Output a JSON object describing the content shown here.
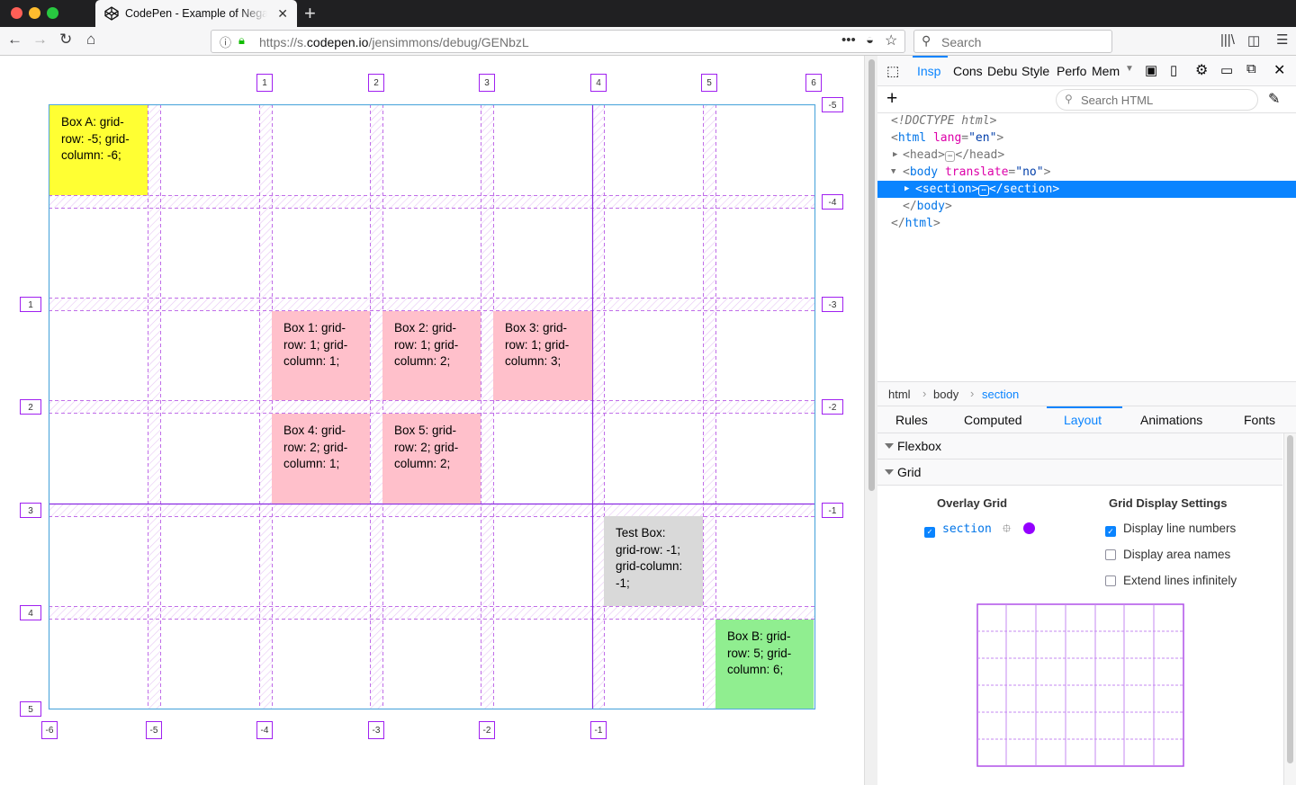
{
  "browser": {
    "tab_title": "CodePen - Example of Negative",
    "url_prefix": "https://s.",
    "url_domain": "codepen.io",
    "url_path": "/jensimmons/debug/GENbzL",
    "search_placeholder": "Search"
  },
  "page": {
    "box_a": "Box A: grid-row: -5; grid-column: -6;",
    "box_1": "Box 1: grid-row: 1; grid-column: 1;",
    "box_2": "Box 2: grid-row: 1; grid-column: 2;",
    "box_3": "Box 3: grid-row: 1; grid-column: 3;",
    "box_4": "Box 4: grid-row: 2; grid-column: 1;",
    "box_5": "Box 5: grid-row: 2; grid-column: 2;",
    "test_box": "Test Box: grid-row: -1; grid-column: -1;",
    "box_b": "Box B: grid-row: 5; grid-column: 6;",
    "top_numbers": [
      "1",
      "2",
      "3",
      "4",
      "5",
      "6"
    ],
    "right_numbers": [
      "-5",
      "-4",
      "-3",
      "-2",
      "-1"
    ],
    "left_numbers": [
      "1",
      "2",
      "3",
      "4",
      "5"
    ],
    "bottom_numbers": [
      "-6",
      "-5",
      "-4",
      "-3",
      "-2",
      "-1"
    ],
    "colors": {
      "box_a": "#ffff33",
      "box_pink": "#ffc0cb",
      "test_box": "#d9d9d9",
      "box_b": "#90ee90",
      "overlay": "#a020f0"
    }
  },
  "devtools": {
    "tabs": [
      "Inspector",
      "Console",
      "Debugger",
      "Style Editor",
      "Performance",
      "Memory"
    ],
    "tabs_short": [
      "Insp",
      "Cons",
      "Debu",
      "Style",
      "Perfo",
      "Mem"
    ],
    "search_html": "Search HTML",
    "markup": {
      "doctype": "<!DOCTYPE html>",
      "html_open_tag": "html",
      "html_attr": "lang",
      "html_val": "\"en\"",
      "head": "head",
      "body_tag": "body",
      "body_attr": "translate",
      "body_val": "\"no\"",
      "section": "section",
      "body_close": "body",
      "html_close": "html"
    },
    "breadcrumbs": [
      "html",
      "body",
      "section"
    ],
    "side_tabs": [
      "Rules",
      "Computed",
      "Layout",
      "Animations",
      "Fonts"
    ],
    "flexbox_label": "Flexbox",
    "grid_label": "Grid",
    "overlay_grid_heading": "Overlay Grid",
    "overlay_item": "section",
    "overlay_color": "#9400ff",
    "display_settings_heading": "Grid Display Settings",
    "settings": [
      {
        "label": "Display line numbers",
        "checked": true
      },
      {
        "label": "Display area names",
        "checked": false
      },
      {
        "label": "Extend lines infinitely",
        "checked": false
      }
    ]
  }
}
